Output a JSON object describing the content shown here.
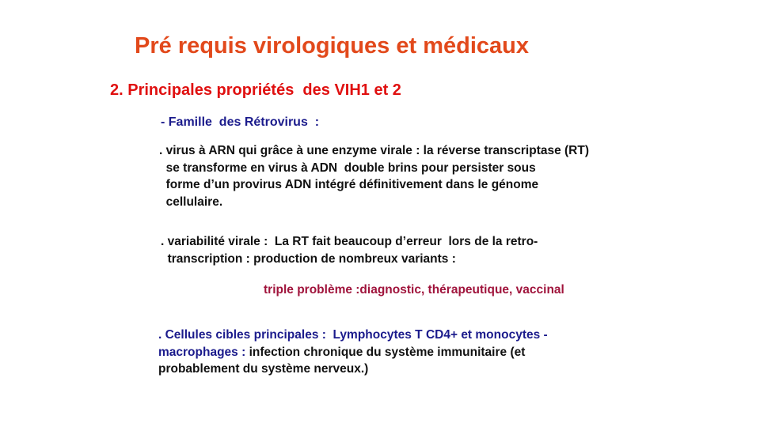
{
  "slide": {
    "title": "Pré requis virologiques et médicaux",
    "subtitle": "2. Principales propriétés  des VIH1 et 2",
    "family": "- Famille  des Rétrovirus  :",
    "paragraph1": [
      ". virus à ARN qui grâce à une enzyme virale : la réverse transcriptase (RT)",
      "  se transforme en virus à ADN  double brins pour persister sous",
      "  forme d’un provirus ADN intégré définitivement dans le génome",
      "  cellulaire."
    ],
    "paragraph2": [
      ". variabilité virale :  La RT fait beaucoup d’erreur  lors de la retro-",
      "  transcription : production de nombreux variants :"
    ],
    "problem": "triple problème :diagnostic, thérapeutique, vaccinal",
    "paragraph3": {
      "line1": ". Cellules cibles principales :  Lymphocytes T CD4+ et monocytes -",
      "line2_blue": "macrophages :",
      "line2_rest": " infection chronique du système immunitaire (et",
      "line3": "probablement du système nerveux.)"
    }
  },
  "colors": {
    "title": "#e2491b",
    "subtitle": "#e01010",
    "blue_text": "#1b1b8c",
    "problem": "#a0143c",
    "body": "#111111"
  }
}
